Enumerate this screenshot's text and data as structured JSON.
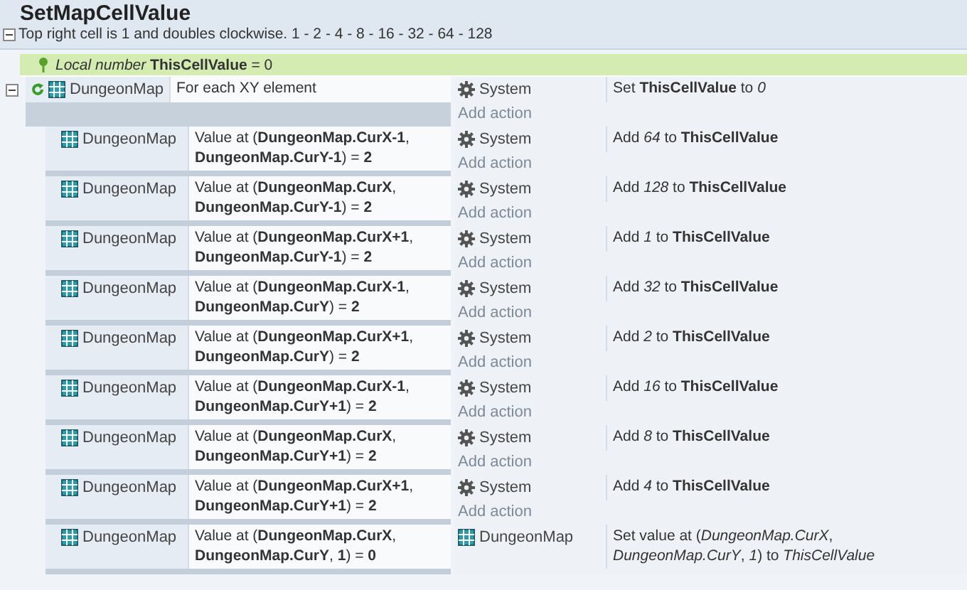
{
  "title": "SetMapCellValue",
  "comment": "Top right cell is 1 and doubles clockwise. 1 - 2 - 4 - 8 - 16 - 32 - 64 - 128",
  "local_variable": "*Local number* **ThisCellValue** = 0",
  "event": {
    "object": "DungeonMap",
    "condition": [
      "For each XY element"
    ],
    "actions": [
      {
        "kind": "system",
        "object": "System",
        "text": "Set **ThisCellValue** to *0*"
      }
    ],
    "add_action": "Add action",
    "sub_events": [
      {
        "object": "DungeonMap",
        "condition": [
          "Value at (**DungeonMap.CurX-1**,",
          "**DungeonMap.CurY-1**) = **2**"
        ],
        "actions": [
          {
            "kind": "system",
            "object": "System",
            "text": "Add *64* to **ThisCellValue**"
          }
        ],
        "add_action": "Add action"
      },
      {
        "object": "DungeonMap",
        "condition": [
          "Value at (**DungeonMap.CurX**,",
          "**DungeonMap.CurY-1**) = **2**"
        ],
        "actions": [
          {
            "kind": "system",
            "object": "System",
            "text": "Add *128* to **ThisCellValue**"
          }
        ],
        "add_action": "Add action"
      },
      {
        "object": "DungeonMap",
        "condition": [
          "Value at (**DungeonMap.CurX+1**,",
          "**DungeonMap.CurY-1**) = **2**"
        ],
        "actions": [
          {
            "kind": "system",
            "object": "System",
            "text": "Add *1* to **ThisCellValue**"
          }
        ],
        "add_action": "Add action"
      },
      {
        "object": "DungeonMap",
        "condition": [
          "Value at (**DungeonMap.CurX-1**,",
          "**DungeonMap.CurY**) = **2**"
        ],
        "actions": [
          {
            "kind": "system",
            "object": "System",
            "text": "Add *32* to **ThisCellValue**"
          }
        ],
        "add_action": "Add action"
      },
      {
        "object": "DungeonMap",
        "condition": [
          "Value at (**DungeonMap.CurX+1**,",
          "**DungeonMap.CurY**) = **2**"
        ],
        "actions": [
          {
            "kind": "system",
            "object": "System",
            "text": "Add *2* to **ThisCellValue**"
          }
        ],
        "add_action": "Add action"
      },
      {
        "object": "DungeonMap",
        "condition": [
          "Value at (**DungeonMap.CurX-1**,",
          "**DungeonMap.CurY+1**) = **2**"
        ],
        "actions": [
          {
            "kind": "system",
            "object": "System",
            "text": "Add *16* to **ThisCellValue**"
          }
        ],
        "add_action": "Add action"
      },
      {
        "object": "DungeonMap",
        "condition": [
          "Value at (**DungeonMap.CurX**,",
          "**DungeonMap.CurY+1**) = **2**"
        ],
        "actions": [
          {
            "kind": "system",
            "object": "System",
            "text": "Add *8* to **ThisCellValue**"
          }
        ],
        "add_action": "Add action"
      },
      {
        "object": "DungeonMap",
        "condition": [
          "Value at (**DungeonMap.CurX+1**,",
          "**DungeonMap.CurY+1**) = **2**"
        ],
        "actions": [
          {
            "kind": "system",
            "object": "System",
            "text": "Add *4* to **ThisCellValue**"
          }
        ],
        "add_action": "Add action"
      },
      {
        "object": "DungeonMap",
        "condition": [
          "Value at (**DungeonMap.CurX**,",
          "**DungeonMap.CurY**, **1**) = **0**"
        ],
        "actions": [
          {
            "kind": "array",
            "object": "DungeonMap",
            "text": "Set value at (*DungeonMap.CurX*, *DungeonMap.CurY*, *1*) to *ThisCellValue*"
          }
        ]
      }
    ]
  }
}
